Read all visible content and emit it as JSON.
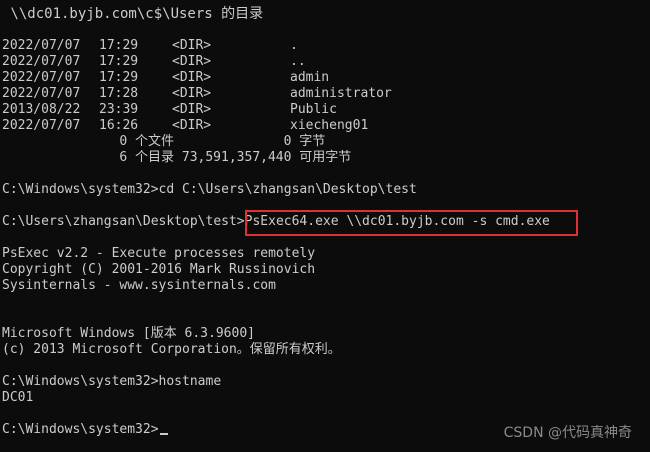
{
  "header": {
    "dir_of": " \\\\dc01.byjb.com\\c$\\Users 的目录"
  },
  "listing": [
    {
      "date": "2022/07/07",
      "time": "17:29",
      "kind": "<DIR>",
      "name": "."
    },
    {
      "date": "2022/07/07",
      "time": "17:29",
      "kind": "<DIR>",
      "name": ".."
    },
    {
      "date": "2022/07/07",
      "time": "17:29",
      "kind": "<DIR>",
      "name": "admin"
    },
    {
      "date": "2022/07/07",
      "time": "17:28",
      "kind": "<DIR>",
      "name": "administrator"
    },
    {
      "date": "2013/08/22",
      "time": "23:39",
      "kind": "<DIR>",
      "name": "Public"
    },
    {
      "date": "2022/07/07",
      "time": "16:26",
      "kind": "<DIR>",
      "name": "xiecheng01"
    }
  ],
  "summary": {
    "files": "               0 个文件              0 字节",
    "dirs": "               6 个目录 73,591,357,440 可用字节"
  },
  "commands": {
    "cd_line": "C:\\Windows\\system32>cd C:\\Users\\zhangsan\\Desktop\\test",
    "psexec_prompt": "C:\\Users\\zhangsan\\Desktop\\test>",
    "psexec_cmd": "PsExec64.exe \\\\dc01.byjb.com -s cmd.exe"
  },
  "psexec_banner": {
    "line1": "PsExec v2.2 - Execute processes remotely",
    "line2": "Copyright (C) 2001-2016 Mark Russinovich",
    "line3": "Sysinternals - www.sysinternals.com"
  },
  "windows_banner": {
    "line1": "Microsoft Windows [版本 6.3.9600]",
    "line2": "(c) 2013 Microsoft Corporation。保留所有权利。"
  },
  "session": {
    "hostname_cmd": "C:\\Windows\\system32>hostname",
    "hostname_output": "DC01",
    "final_prompt": "C:\\Windows\\system32>"
  },
  "watermark": "CSDN @代码真神奇",
  "colors": {
    "background": "#0c0c0c",
    "text": "#cccccc",
    "highlight_border": "#e03131"
  }
}
